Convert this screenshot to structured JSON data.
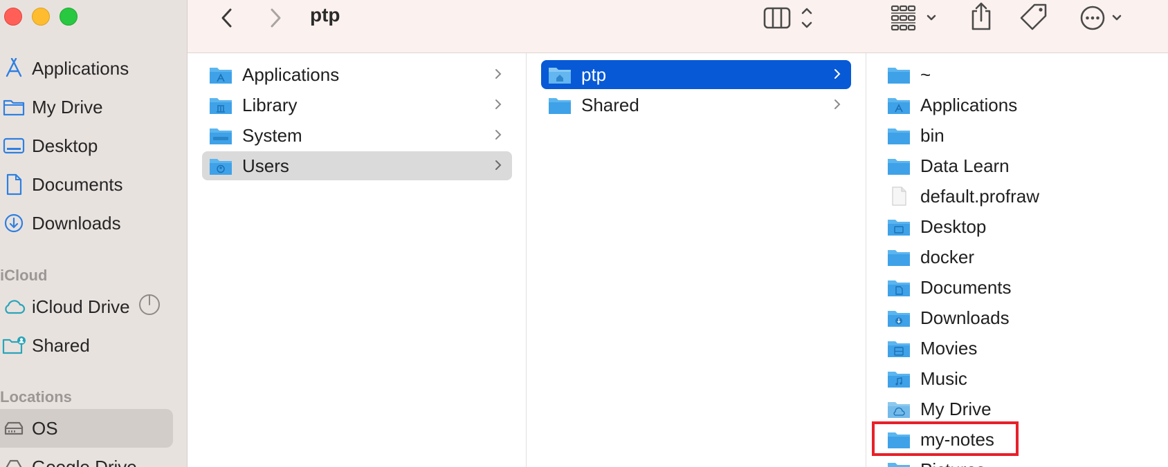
{
  "window": {
    "title": "ptp"
  },
  "sidebar": {
    "items": [
      {
        "label": "Applications",
        "icon": "applications-icon"
      },
      {
        "label": "My Drive",
        "icon": "folder-icon"
      },
      {
        "label": "Desktop",
        "icon": "desktop-icon"
      },
      {
        "label": "Documents",
        "icon": "document-icon"
      },
      {
        "label": "Downloads",
        "icon": "download-icon"
      }
    ],
    "icloud_header": "iCloud",
    "icloud_items": [
      {
        "label": "iCloud Drive",
        "icon": "cloud-icon"
      },
      {
        "label": "Shared",
        "icon": "shared-folder-icon"
      }
    ],
    "locations_header": "Locations",
    "location_items": [
      {
        "label": "OS",
        "icon": "drive-icon",
        "selected": true
      },
      {
        "label": "Google Drive",
        "icon": "google-drive-icon"
      }
    ]
  },
  "columns": {
    "col1": [
      {
        "label": "Applications",
        "selected": false
      },
      {
        "label": "Library",
        "selected": false
      },
      {
        "label": "System",
        "selected": false
      },
      {
        "label": "Users",
        "selected": true
      }
    ],
    "col2": [
      {
        "label": "ptp",
        "selected": true
      },
      {
        "label": "Shared",
        "selected": false
      }
    ],
    "col3": [
      {
        "label": "~",
        "type": "folder"
      },
      {
        "label": "Applications",
        "type": "folder"
      },
      {
        "label": "bin",
        "type": "folder"
      },
      {
        "label": "Data Learn",
        "type": "folder"
      },
      {
        "label": "default.profraw",
        "type": "file"
      },
      {
        "label": "Desktop",
        "type": "folder"
      },
      {
        "label": "docker",
        "type": "folder"
      },
      {
        "label": "Documents",
        "type": "folder"
      },
      {
        "label": "Downloads",
        "type": "folder"
      },
      {
        "label": "Movies",
        "type": "folder"
      },
      {
        "label": "Music",
        "type": "folder"
      },
      {
        "label": "My Drive",
        "type": "folder"
      },
      {
        "label": "my-notes",
        "type": "folder",
        "highlighted": true
      },
      {
        "label": "Pictures",
        "type": "folder"
      }
    ]
  },
  "colors": {
    "selection_blue": "#0759d6",
    "highlight_red": "#e8202a",
    "folder_blue": "#5bb5ef"
  }
}
